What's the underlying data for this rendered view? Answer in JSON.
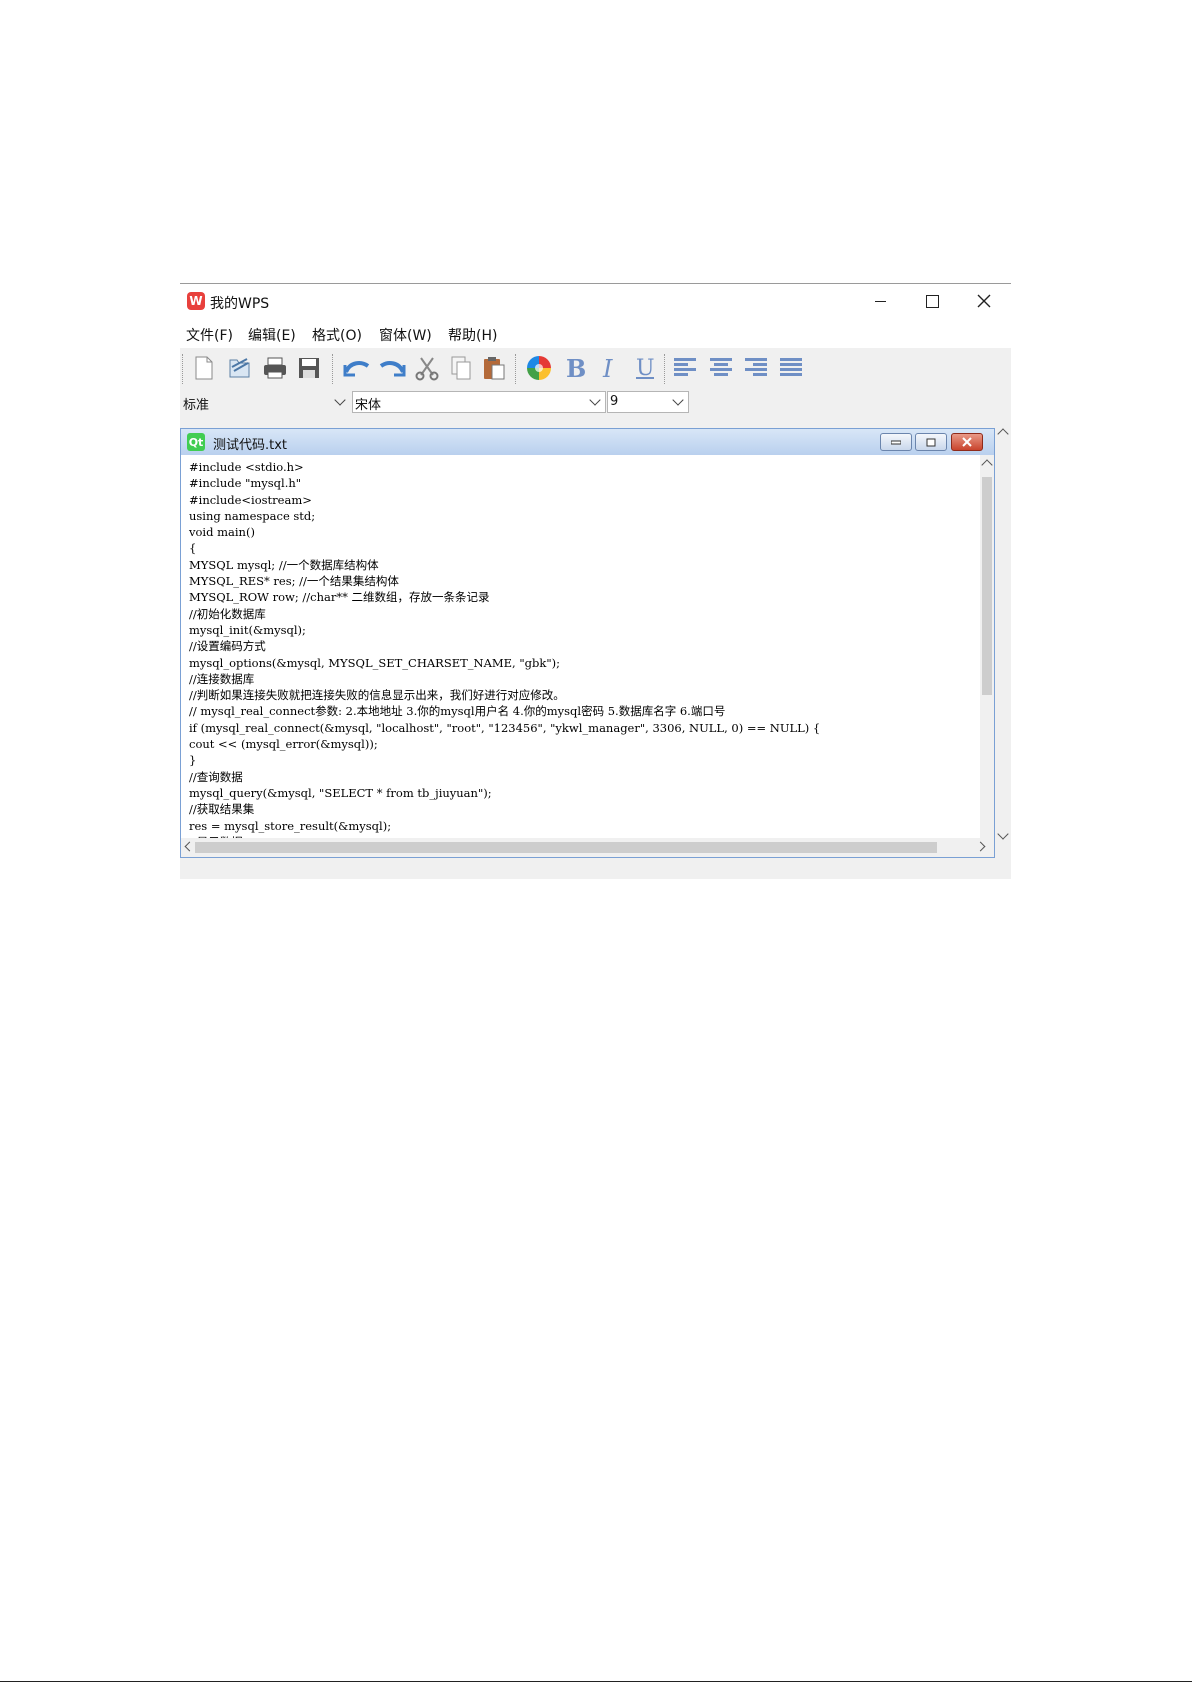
{
  "app": {
    "logo_text": "W",
    "title": "我的WPS"
  },
  "menu": [
    "文件(F)",
    "编辑(E)",
    "格式(O)",
    "窗体(W)",
    "帮助(H)"
  ],
  "toolbar_icons": [
    "new-file-icon",
    "open-file-icon",
    "print-icon",
    "save-icon",
    "undo-icon",
    "redo-icon",
    "cut-icon",
    "copy-icon",
    "paste-icon",
    "color-picker-icon",
    "bold-icon",
    "italic-icon",
    "underline-icon",
    "align-left-icon",
    "align-center-icon",
    "align-right-icon",
    "justify-icon"
  ],
  "format": {
    "style": "标准",
    "font": "宋体",
    "size": "9"
  },
  "document": {
    "qt_logo": "Qt",
    "name": "测试代码.txt",
    "lines": [
      "#include <stdio.h>",
      "#include \"mysql.h\"",
      "#include<iostream>",
      "using namespace std;",
      "void main()",
      "{",
      "MYSQL mysql; //一个数据库结构体",
      "MYSQL_RES* res; //一个结果集结构体",
      "MYSQL_ROW row; //char** 二维数组，存放一条条记录",
      "//初始化数据库",
      "mysql_init(&mysql);",
      "//设置编码方式",
      "mysql_options(&mysql, MYSQL_SET_CHARSET_NAME, \"gbk\");",
      "//连接数据库",
      "//判断如果连接失败就把连接失败的信息显示出来，我们好进行对应修改。",
      "// mysql_real_connect参数: 2.本地地址 3.你的mysql用户名 4.你的mysql密码 5.数据库名字 6.端口号",
      "if (mysql_real_connect(&mysql, \"localhost\", \"root\", \"123456\", \"ykwl_manager\", 3306, NULL, 0) == NULL) {",
      "cout << (mysql_error(&mysql));",
      "}",
      "//查询数据",
      "mysql_query(&mysql, \"SELECT * from tb_jiuyuan\");",
      "//获取结果集",
      "res = mysql_store_result(&mysql);",
      "//显示数据"
    ]
  },
  "colors": {
    "app_logo": "#e8403c",
    "qt_logo": "#41cd52",
    "child_title": "#b9d0ee",
    "close_button": "#c9442d"
  }
}
